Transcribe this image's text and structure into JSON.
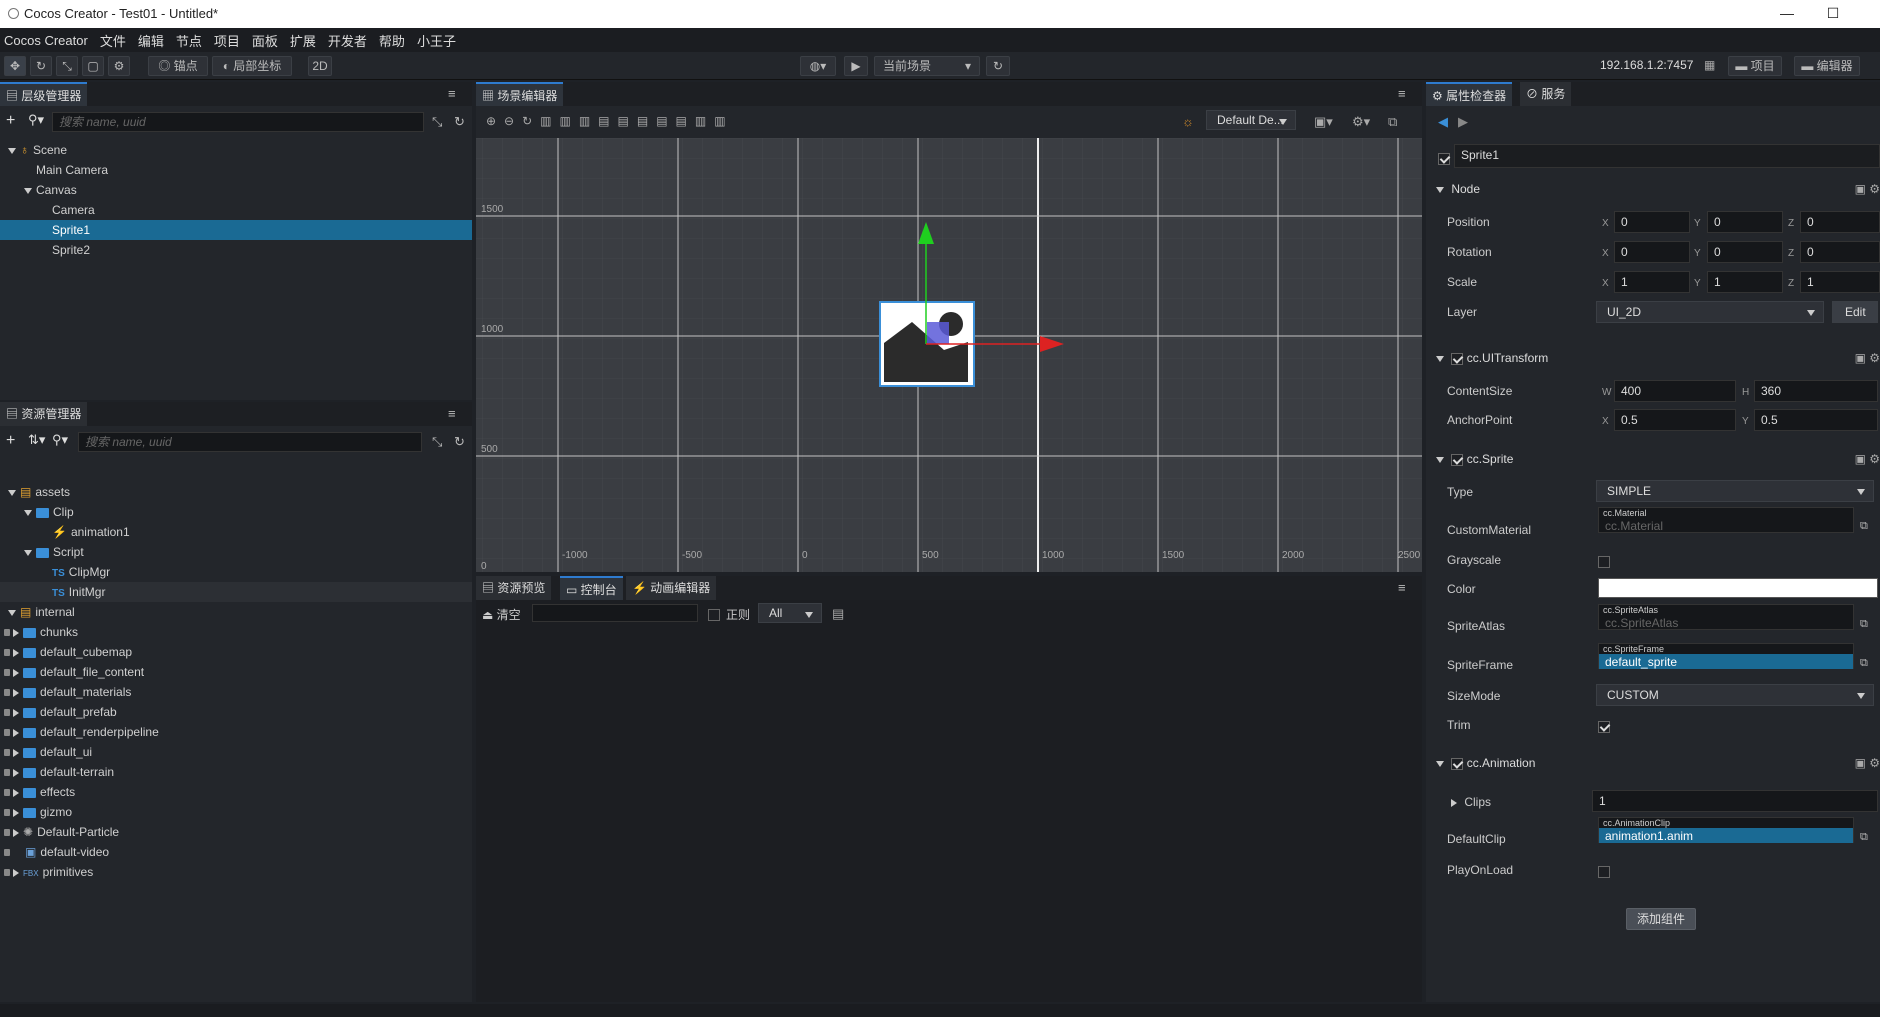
{
  "window": {
    "title": "Cocos Creator - Test01 - Untitled*",
    "minimize": "—",
    "maximize": "☐",
    "close": "✕"
  },
  "menu": [
    "Cocos Creator",
    "文件",
    "编辑",
    "节点",
    "项目",
    "面板",
    "扩展",
    "开发者",
    "帮助",
    "小王子"
  ],
  "toolbar": {
    "anchor_label": "锚点",
    "local_label": "局部坐标",
    "mode_2d": "2D",
    "scene_select": "当前场景",
    "ip": "192.168.1.2:7457",
    "project_btn": "项目",
    "editor_btn": "编辑器"
  },
  "hierarchy": {
    "tab": "层级管理器",
    "search_placeholder": "搜索 name, uuid",
    "items": [
      {
        "label": "Scene",
        "indent": 0,
        "arrow": "down",
        "icon": "scene"
      },
      {
        "label": "Main Camera",
        "indent": 1,
        "arrow": "",
        "icon": ""
      },
      {
        "label": "Canvas",
        "indent": 1,
        "arrow": "down",
        "icon": ""
      },
      {
        "label": "Camera",
        "indent": 2,
        "arrow": "",
        "icon": ""
      },
      {
        "label": "Sprite1",
        "indent": 2,
        "arrow": "",
        "icon": "",
        "selected": true
      },
      {
        "label": "Sprite2",
        "indent": 2,
        "arrow": "",
        "icon": ""
      }
    ]
  },
  "assets": {
    "tab": "资源管理器",
    "search_placeholder": "搜索 name, uuid",
    "items": [
      {
        "label": "assets",
        "type": "db"
      },
      {
        "label": "Clip",
        "type": "folder"
      },
      {
        "label": "animation1",
        "type": "anim"
      },
      {
        "label": "Script",
        "type": "folder"
      },
      {
        "label": "ClipMgr",
        "type": "ts"
      },
      {
        "label": "InitMgr",
        "type": "ts"
      },
      {
        "label": "internal",
        "type": "db"
      },
      {
        "label": "chunks",
        "type": "ifolder"
      },
      {
        "label": "default_cubemap",
        "type": "ifolder"
      },
      {
        "label": "default_file_content",
        "type": "ifolder"
      },
      {
        "label": "default_materials",
        "type": "ifolder"
      },
      {
        "label": "default_prefab",
        "type": "ifolder"
      },
      {
        "label": "default_renderpipeline",
        "type": "ifolder"
      },
      {
        "label": "default_ui",
        "type": "ifolder"
      },
      {
        "label": "default-terrain",
        "type": "ifolder"
      },
      {
        "label": "effects",
        "type": "ifolder"
      },
      {
        "label": "gizmo",
        "type": "ifolder"
      },
      {
        "label": "Default-Particle",
        "type": "iparticle"
      },
      {
        "label": "default-video",
        "type": "ivideo"
      },
      {
        "label": "primitives",
        "type": "ifbx"
      }
    ]
  },
  "scene_editor": {
    "tab": "场景编辑器",
    "camera_select": "Default De...",
    "y_labels": [
      "1500",
      "1000",
      "500",
      "0"
    ],
    "x_labels": [
      "-1000",
      "-500",
      "0",
      "500",
      "1000",
      "1500",
      "2000",
      "2500"
    ]
  },
  "console": {
    "tabs": [
      "资源预览",
      "控制台",
      "动画编辑器"
    ],
    "clear": "清空",
    "regex": "正则",
    "filter": "All"
  },
  "inspector": {
    "tabs": [
      "属性检查器",
      "服务"
    ],
    "node_name": "Sprite1",
    "node_section": "Node",
    "position": {
      "label": "Position",
      "x": "0",
      "y": "0",
      "z": "0"
    },
    "rotation": {
      "label": "Rotation",
      "x": "0",
      "y": "0",
      "z": "0"
    },
    "scale": {
      "label": "Scale",
      "x": "1",
      "y": "1",
      "z": "1"
    },
    "layer": {
      "label": "Layer",
      "value": "UI_2D",
      "edit": "Edit"
    },
    "uitransform": {
      "title": "cc.UITransform",
      "content_label": "ContentSize",
      "w": "400",
      "h": "360",
      "anchor_label": "AnchorPoint",
      "ax": "0.5",
      "ay": "0.5"
    },
    "sprite": {
      "title": "cc.Sprite",
      "type_label": "Type",
      "type_value": "SIMPLE",
      "custom_label": "CustomMaterial",
      "custom_tag": "cc.Material",
      "custom_value": "cc.Material",
      "grayscale_label": "Grayscale",
      "color_label": "Color",
      "atlas_label": "SpriteAtlas",
      "atlas_tag": "cc.SpriteAtlas",
      "atlas_value": "cc.SpriteAtlas",
      "frame_label": "SpriteFrame",
      "frame_tag": "cc.SpriteFrame",
      "frame_value": "default_sprite",
      "sizemode_label": "SizeMode",
      "sizemode_value": "CUSTOM",
      "trim_label": "Trim"
    },
    "animation": {
      "title": "cc.Animation",
      "clips_label": "Clips",
      "clips_value": "1",
      "default_label": "DefaultClip",
      "default_tag": "cc.AnimationClip",
      "default_value": "animation1.anim",
      "playonload_label": "PlayOnLoad"
    },
    "add_component": "添加组件"
  },
  "axis_letters": {
    "x": "X",
    "y": "Y",
    "z": "Z",
    "w": "W",
    "h": "H"
  }
}
